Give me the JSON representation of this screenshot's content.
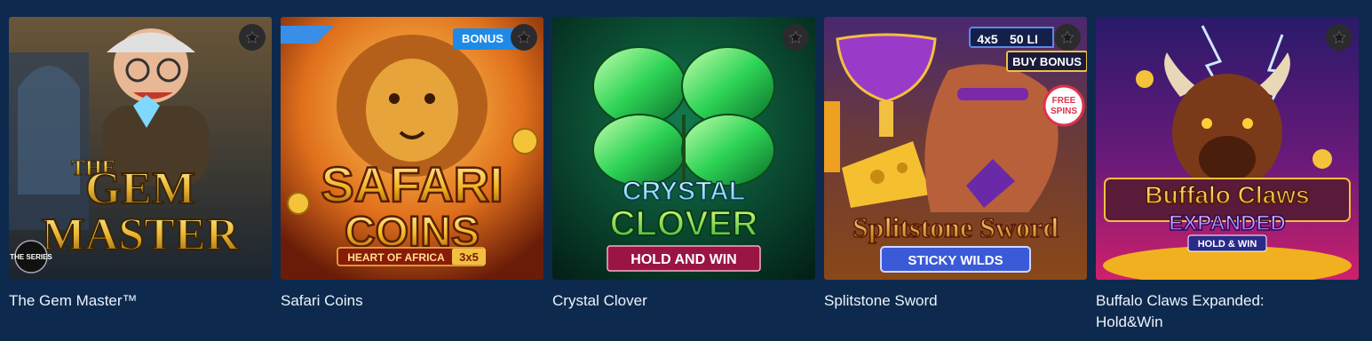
{
  "games": [
    {
      "title": "The Gem Master™",
      "logo_small": "THE",
      "logo_line1": "GEM",
      "logo_line2": "MASTER",
      "series_badge": "THE SERIES",
      "colors": {
        "bg1": "#5a4a36",
        "bg2": "#1d2733",
        "accent": "#f4c542"
      }
    },
    {
      "title": "Safari Coins",
      "corner_badge": "BONUS",
      "logo_line1": "SAFARI",
      "logo_line2": "COINS",
      "sub_banner": "HEART OF AFRICA",
      "sub_badge": "3x5",
      "colors": {
        "bg1": "#f2a23a",
        "bg2": "#8a2a0c",
        "accent": "#ffd44a"
      }
    },
    {
      "title": "Crystal Clover",
      "logo_line1": "CRYSTAL",
      "logo_line2": "CLOVER",
      "sub_banner": "HOLD AND WIN",
      "colors": {
        "bg1": "#0e6b45",
        "bg2": "#04261c",
        "accent": "#58ff74"
      }
    },
    {
      "title": "Splitstone Sword",
      "top_badge_left": "4x5",
      "top_badge_right": "50 LI",
      "buy_badge": "BUY BONUS",
      "free_badge_line1": "FREE",
      "free_badge_line2": "SPINS",
      "logo_line1": "Splitstone Sword",
      "sub_banner": "STICKY WILDS",
      "colors": {
        "bg1": "#4a2a6e",
        "bg2": "#7a3d1a",
        "accent": "#f0b028"
      }
    },
    {
      "title": "Buffalo Claws Expanded: Hold&Win",
      "logo_line1": "Buffalo Claws",
      "logo_line2": "EXPANDED",
      "sub_banner": "HOLD & WIN",
      "colors": {
        "bg1": "#2d1a66",
        "bg2": "#b01a6a",
        "accent": "#ffd23a"
      }
    }
  ],
  "icons": {
    "favorite": "star-icon"
  }
}
